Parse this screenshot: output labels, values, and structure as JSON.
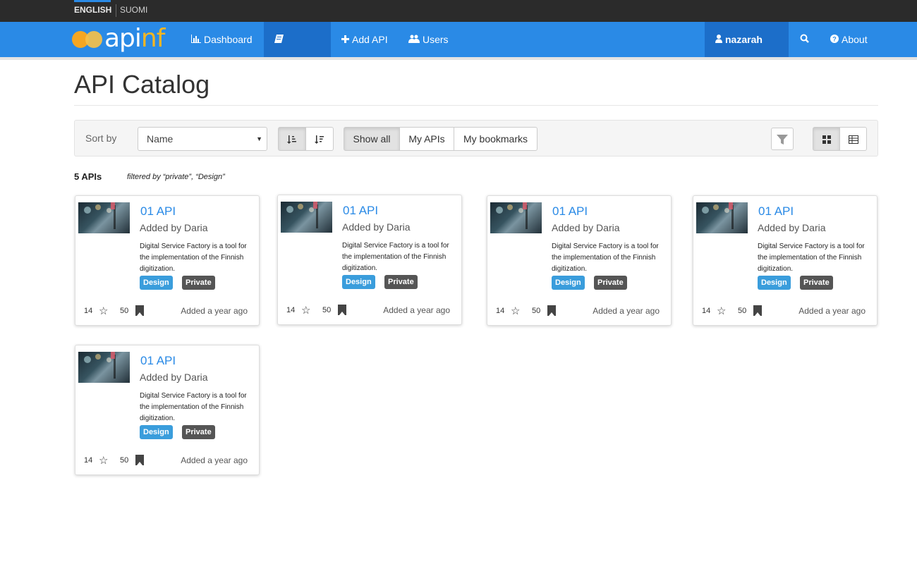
{
  "languages": [
    {
      "label": "ENGLISH",
      "active": true
    },
    {
      "label": "SUOMI",
      "active": false
    }
  ],
  "logo": {
    "text_main": "api",
    "text_accent": "nf"
  },
  "nav": {
    "dashboard": "Dashboard",
    "catalog": "Catalog",
    "add_api": "Add API",
    "users": "Users",
    "user": "nazarah",
    "about": "About"
  },
  "page": {
    "title": "API Catalog"
  },
  "toolbar": {
    "sort_label": "Sort by",
    "sort_value": "Name",
    "show_all": "Show all",
    "my_apis": "My APIs",
    "my_bookmarks": "My bookmarks"
  },
  "results": {
    "count": "5 APIs",
    "filtered": "filtered by “private”, “Design”"
  },
  "cards": [
    {
      "name": "01 API",
      "author": "Added by Daria",
      "description": "Digital Service Factory is a tool for the implementation of the Finnish digitization.",
      "tags": [
        "Design",
        "Private"
      ],
      "rating": "14",
      "bookmarks": "50",
      "added": "Added a year ago"
    },
    {
      "name": "01 API",
      "author": "Added by Daria",
      "description": "Digital Service Factory is a tool for the implementation of the Finnish digitization.",
      "tags": [
        "Design",
        "Private"
      ],
      "rating": "14",
      "bookmarks": "50",
      "added": "Added a year ago"
    },
    {
      "name": "01 API",
      "author": "Added by Daria",
      "description": "Digital Service Factory is a tool for the implementation of the Finnish digitization.",
      "tags": [
        "Design",
        "Private"
      ],
      "rating": "14",
      "bookmarks": "50",
      "added": "Added a year ago"
    },
    {
      "name": "01 API",
      "author": "Added by Daria",
      "description": "Digital Service Factory is a tool for the implementation of the Finnish digitization.",
      "tags": [
        "Design",
        "Private"
      ],
      "rating": "14",
      "bookmarks": "50",
      "added": "Added a year ago"
    },
    {
      "name": "01 API",
      "author": "Added by Daria",
      "description": "Digital Service Factory is a tool for the implementation of the Finnish digitization.",
      "tags": [
        "Design",
        "Private"
      ],
      "rating": "14",
      "bookmarks": "50",
      "added": "Added a year ago"
    }
  ],
  "colors": {
    "primary": "#2a8ae6",
    "primary_dark": "#1c6ec9",
    "topbar": "#2b2b2b",
    "tag_design": "#3a9ddc",
    "tag_private": "#555555",
    "logo_accent": "#f5a623"
  },
  "icons": {
    "dashboard": "bar-chart-icon",
    "catalog": "book-icon",
    "add_api": "plus-icon",
    "users": "users-icon",
    "user": "user-icon",
    "search": "search-icon",
    "about": "question-icon"
  }
}
